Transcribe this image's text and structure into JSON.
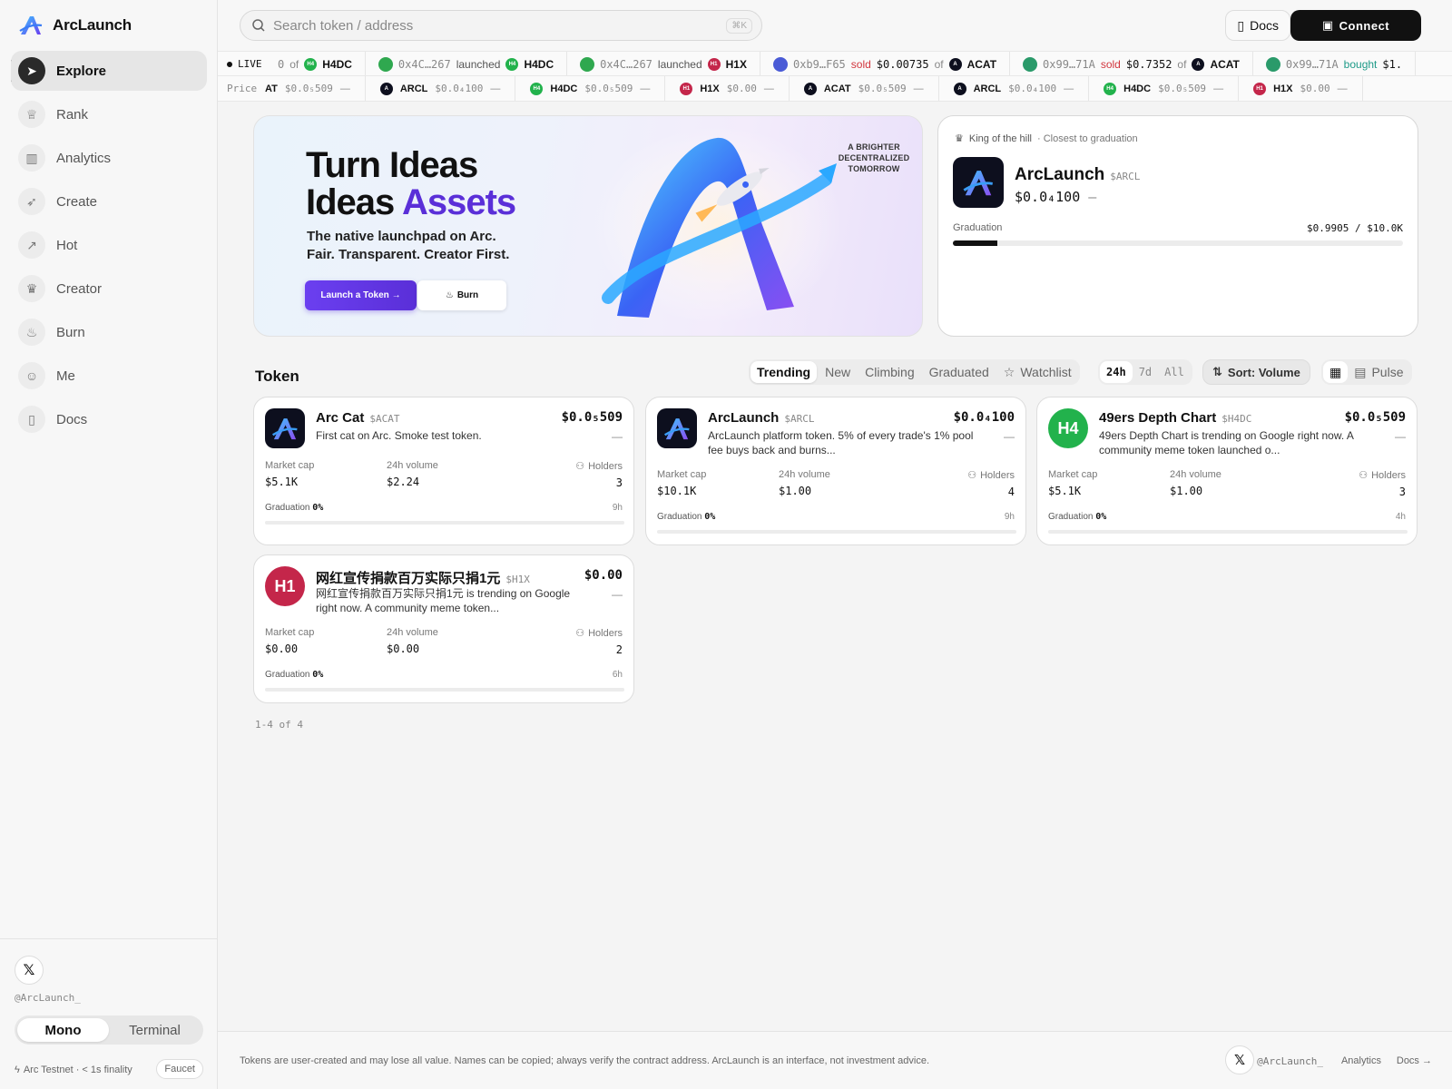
{
  "brand": {
    "name": "ArcLaunch"
  },
  "nav": [
    {
      "label": "Explore",
      "icon": "compass-icon"
    },
    {
      "label": "Rank",
      "icon": "trophy-icon"
    },
    {
      "label": "Analytics",
      "icon": "bar-chart-icon"
    },
    {
      "label": "Create",
      "icon": "rocket-icon"
    },
    {
      "label": "Hot",
      "icon": "trend-up-icon"
    },
    {
      "label": "Creator",
      "icon": "crown-icon"
    },
    {
      "label": "Burn",
      "icon": "flame-icon"
    },
    {
      "label": "Me",
      "icon": "user-circle-icon"
    },
    {
      "label": "Docs",
      "icon": "book-icon"
    }
  ],
  "sidebar_bottom": {
    "handle": "@ArcLaunch_",
    "modes": [
      "Mono",
      "Terminal"
    ],
    "selected_mode": "Mono",
    "network": "Arc Testnet · < 1s finality",
    "faucet": "Faucet"
  },
  "topbar": {
    "search_placeholder": "Search token / address",
    "shortcut": "⌘K",
    "docs": "Docs",
    "connect": "Connect"
  },
  "ticker": {
    "live": "LIVE",
    "events": [
      {
        "lead": "0",
        "action": "of",
        "action_type": "of",
        "token": "H4DC",
        "token_color": "#22b24c"
      },
      {
        "addr": "0x4C…267",
        "action": "launched",
        "action_type": "launched",
        "token": "H4DC",
        "token_color": "#22b24c",
        "avatar_color": "#2fa84f"
      },
      {
        "addr": "0x4C…267",
        "action": "launched",
        "action_type": "launched",
        "token": "H1X",
        "token_color": "#c4264a",
        "avatar_color": "#2fa84f"
      },
      {
        "addr": "0xb9…F65",
        "action": "sold",
        "action_type": "sold",
        "amount": "$0.00735",
        "of": "of",
        "token": "ACAT",
        "token_color": "#0d0f1e",
        "avatar_color": "#4a5bd6"
      },
      {
        "addr": "0x99…71A",
        "action": "sold",
        "action_type": "sold",
        "amount": "$0.7352",
        "of": "of",
        "token": "ACAT",
        "token_color": "#0d0f1e",
        "avatar_color": "#2a9a6a"
      },
      {
        "addr": "0x99…71A",
        "action": "bought",
        "action_type": "bought",
        "amount": "$1.",
        "of": "",
        "token": "",
        "token_color": "#0d0f1e",
        "avatar_color": "#2a9a6a"
      }
    ]
  },
  "price_ticker": {
    "label": "Price",
    "items": [
      {
        "sym": "AT",
        "price": "$0.0₅509",
        "chg": "—",
        "icon_color": ""
      },
      {
        "sym": "ARCL",
        "price": "$0.0₄100",
        "chg": "—",
        "icon_color": "#0d0f1e"
      },
      {
        "sym": "H4DC",
        "price": "$0.0₅509",
        "chg": "—",
        "icon_color": "#22b24c"
      },
      {
        "sym": "H1X",
        "price": "$0.00",
        "chg": "—",
        "icon_color": "#c4264a"
      },
      {
        "sym": "ACAT",
        "price": "$0.0₅509",
        "chg": "—",
        "icon_color": "#0d0f1e"
      },
      {
        "sym": "ARCL",
        "price": "$0.0₄100",
        "chg": "—",
        "icon_color": "#0d0f1e"
      },
      {
        "sym": "H4DC",
        "price": "$0.0₅509",
        "chg": "—",
        "icon_color": "#22b24c"
      },
      {
        "sym": "H1X",
        "price": "$0.00",
        "chg": "—",
        "icon_color": "#c4264a"
      }
    ]
  },
  "banner": {
    "line1": "Turn Ideas",
    "line2_a": "Ideas",
    "line2_b": "Assets",
    "sub1": "The native launchpad on Arc.",
    "sub2": "Fair. Transparent. Creator First.",
    "launch_btn": "Launch a Token →",
    "burn_btn": "Burn",
    "tagline": "A BRIGHTER DECENTRALIZED TOMORROW"
  },
  "king": {
    "title": "King of the hill",
    "subtitle": "· Closest to graduation",
    "name": "ArcLaunch",
    "symbol": "$ARCL",
    "price": "$0.0₄100",
    "change": "—",
    "graduation_label": "Graduation",
    "graduation_value": "$0.9905 / $10.0K",
    "graduation_fraction": 0.099
  },
  "tokens": {
    "title": "Token",
    "tabs": [
      "Trending",
      "New",
      "Climbing",
      "Graduated",
      "Watchlist"
    ],
    "selected_tab": "Trending",
    "ranges": [
      "24h",
      "7d",
      "All"
    ],
    "selected_range": "24h",
    "sort": "Sort: Volume",
    "views": [
      "grid",
      "Pulse"
    ],
    "labels": {
      "market_cap": "Market cap",
      "volume": "24h volume",
      "holders": "Holders",
      "graduation": "Graduation"
    },
    "cards": [
      {
        "name": "Arc Cat",
        "symbol": "$ACAT",
        "price": "$0.0₅509",
        "change": "—",
        "desc": "First cat on Arc. Smoke test token.",
        "market_cap": "$5.1K",
        "volume": "$2.24",
        "holders": "3",
        "graduation": "0%",
        "age": "9h",
        "logo": "arc",
        "logo_color": "#0d0f1e"
      },
      {
        "name": "ArcLaunch",
        "symbol": "$ARCL",
        "price": "$0.0₄100",
        "change": "—",
        "desc": "ArcLaunch platform token. 5% of every trade's 1% pool fee buys back and burns...",
        "market_cap": "$10.1K",
        "volume": "$1.00",
        "holders": "4",
        "graduation": "0%",
        "age": "9h",
        "logo": "arc",
        "logo_color": "#0d0f1e"
      },
      {
        "name": "49ers Depth Chart",
        "symbol": "$H4DC",
        "price": "$0.0₅509",
        "change": "—",
        "desc": "49ers Depth Chart is trending on Google right now. A community meme token launched o...",
        "market_cap": "$5.1K",
        "volume": "$1.00",
        "holders": "3",
        "graduation": "0%",
        "age": "4h",
        "logo": "H4",
        "logo_color": "#22b24c"
      },
      {
        "name": "网红宣传捐款百万实际只捐1元",
        "symbol": "$H1X",
        "price": "$0.00",
        "change": "—",
        "desc": "网红宣传捐款百万实际只捐1元 is trending on Google right now. A community meme token...",
        "market_cap": "$0.00",
        "volume": "$0.00",
        "holders": "2",
        "graduation": "0%",
        "age": "6h",
        "logo": "H1",
        "logo_color": "#c4264a"
      }
    ],
    "pager": "1-4 of 4"
  },
  "footer": {
    "disclaimer": "Tokens are user-created and may lose all value. Names can be copied; always verify the contract address. ArcLaunch is an interface, not investment advice.",
    "handle": "@ArcLaunch_",
    "analytics": "Analytics",
    "docs": "Docs →"
  }
}
